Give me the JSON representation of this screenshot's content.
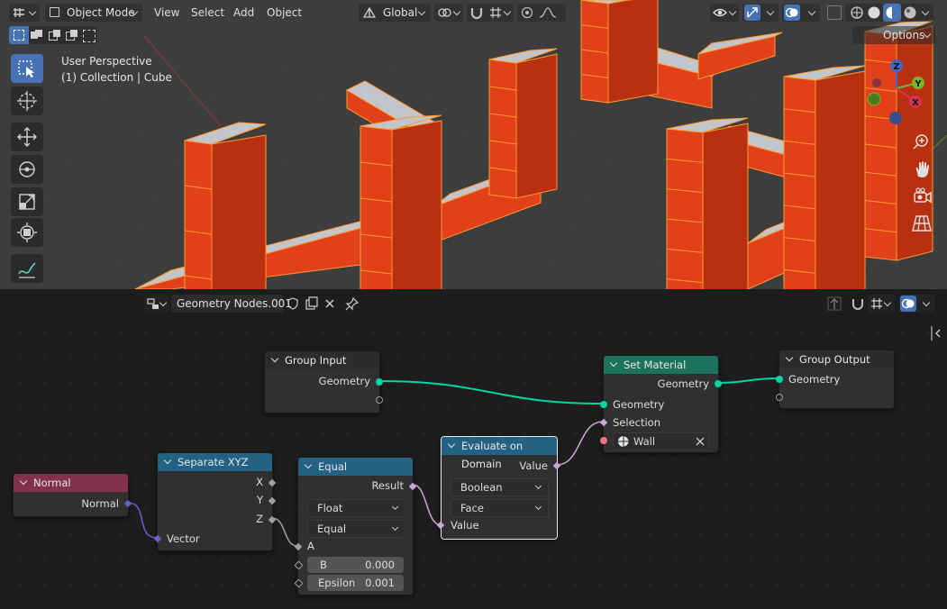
{
  "viewport_header": {
    "mode_label": "Object Mode",
    "menus": [
      "View",
      "Select",
      "Add",
      "Object"
    ],
    "orientation_label": "Global",
    "options_label": "Options"
  },
  "viewport_overlay": {
    "perspective_label": "User Perspective",
    "collection_label": "(1) Collection | Cube"
  },
  "gizmo": {
    "x_label": "X",
    "y_label": "Y",
    "z_label": "Z"
  },
  "node_editor": {
    "tree_name": "Geometry Nodes.001"
  },
  "nodes": {
    "group_input": {
      "title": "Group Input",
      "output_geometry": "Geometry"
    },
    "set_material": {
      "title": "Set Material",
      "out_geometry": "Geometry",
      "in_geometry": "Geometry",
      "in_selection": "Selection",
      "material": "Wall"
    },
    "group_output": {
      "title": "Group Output",
      "in_geometry": "Geometry"
    },
    "normal": {
      "title": "Normal",
      "out_normal": "Normal"
    },
    "separate_xyz": {
      "title": "Separate XYZ",
      "out_x": "X",
      "out_y": "Y",
      "out_z": "Z",
      "in_vector": "Vector"
    },
    "equal": {
      "title": "Equal",
      "out_result": "Result",
      "data_type": "Float",
      "operation": "Equal",
      "in_a": "A",
      "b_label": "B",
      "b_value": "0.000",
      "epsilon_label": "Epsilon",
      "epsilon_value": "0.001"
    },
    "evaluate_on_domain": {
      "title": "Evaluate on Domain",
      "out_value": "Value",
      "data_type": "Boolean",
      "domain": "Face",
      "in_value": "Value"
    }
  },
  "colors": {
    "selected_orange": "#e1401a",
    "outline_orange": "#ff9a2e",
    "geometry_socket": "#00d6a3",
    "boolean_socket": "#cca6d6",
    "vector_socket": "#6363c7",
    "float_socket": "#a1a1a1",
    "material_socket": "#eb7582",
    "header_geometry_node": "#1d725e",
    "header_input_node": "#83314a",
    "header_converter_node": "#246283",
    "active_tool": "#4772b3"
  }
}
